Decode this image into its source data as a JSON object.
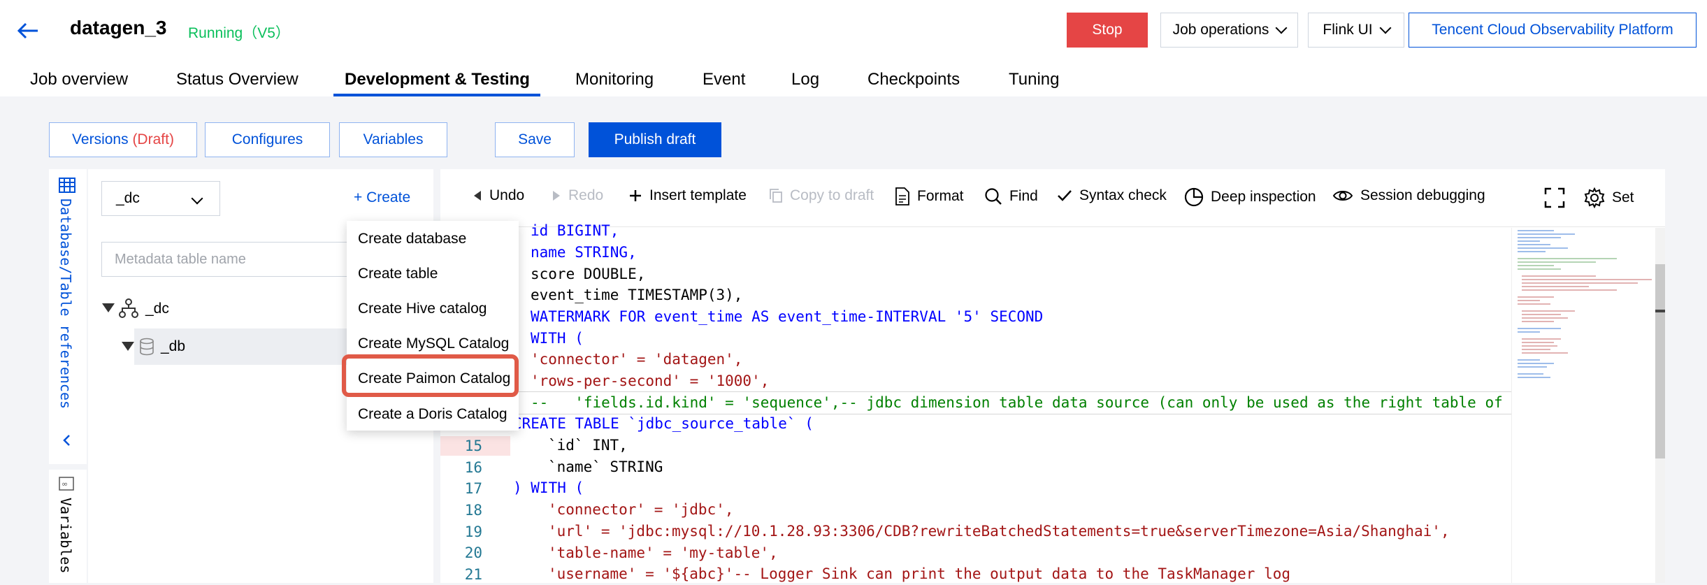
{
  "header": {
    "job_name": "datagen_3",
    "status": "Running（V5）",
    "stop_label": "Stop",
    "job_operations_label": "Job operations",
    "flink_ui_label": "Flink UI",
    "observability_label": "Tencent Cloud Observability Platform"
  },
  "tabs": [
    {
      "label": "Job overview"
    },
    {
      "label": "Status Overview"
    },
    {
      "label": "Development & Testing"
    },
    {
      "label": "Monitoring"
    },
    {
      "label": "Event"
    },
    {
      "label": "Log"
    },
    {
      "label": "Checkpoints"
    },
    {
      "label": "Tuning"
    }
  ],
  "active_tab": "Development & Testing",
  "toolbar": {
    "versions_label": "Versions",
    "versions_draft": "(Draft)",
    "configures_label": "Configures",
    "variables_label": "Variables",
    "save_label": "Save",
    "publish_label": "Publish draft"
  },
  "side_strip": {
    "db_refs_label": "Database/Table references",
    "variables_label": "Variables"
  },
  "tree_panel": {
    "catalog_select": "_dc",
    "create_label": "+ Create",
    "search_placeholder": "Metadata table name",
    "nodes": [
      {
        "label": "_dc"
      },
      {
        "label": "_db"
      }
    ]
  },
  "create_menu": {
    "items": [
      {
        "label": "Create database"
      },
      {
        "label": "Create table"
      },
      {
        "label": "Create Hive catalog"
      },
      {
        "label": "Create MySQL Catalog"
      },
      {
        "label": "Create Paimon Catalog"
      },
      {
        "label": "Create a Doris Catalog"
      }
    ],
    "highlighted": "Create Paimon Catalog"
  },
  "editor_toolbar": {
    "undo": "Undo",
    "redo": "Redo",
    "insert_template": "Insert template",
    "copy_to_draft": "Copy to draft",
    "format": "Format",
    "find": "Find",
    "syntax_check": "Syntax check",
    "deep_inspection": "Deep inspection",
    "session_debugging": "Session debugging",
    "set": "Set"
  },
  "code": {
    "line_numbers": [
      "15",
      "16",
      "17",
      "18",
      "19",
      "20",
      "21"
    ],
    "lines": [
      "id BIGINT,",
      "name STRING,",
      "score DOUBLE,",
      "event_time TIMESTAMP(3),",
      "WATERMARK FOR event_time AS event_time-INTERVAL '5' SECOND",
      "WITH (",
      "'connector' = 'datagen',",
      "'rows-per-second' = '1000',",
      "--   'fields.id.kind' = 'sequence',-- jdbc dimension table data source (can only be used as the right table of a st",
      "CREATE TABLE `jdbc_source_table` (",
      "`id` INT,",
      "`name` STRING",
      ") WITH (",
      "'connector' = 'jdbc',",
      "'url' = 'jdbc:mysql://10.1.28.93:3306/CDB?rewriteBatchedStatements=true&serverTimezone=Asia/Shanghai',",
      "'table-name' = 'my-table',",
      "'username' = '${abc}'-- Logger Sink can print the output data to the TaskManager log"
    ]
  }
}
